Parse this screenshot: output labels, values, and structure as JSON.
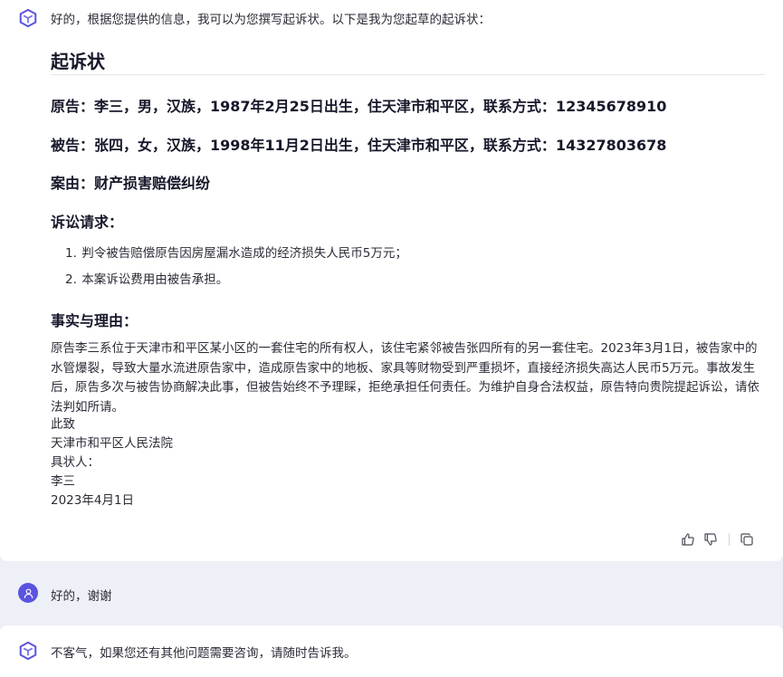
{
  "assistant_message": {
    "intro": "好的，根据您提供的信息，我可以为您撰写起诉状。以下是我为您起草的起诉状：",
    "title": "起诉状",
    "plaintiff": "原告：李三，男，汉族，1987年2月25日出生，住天津市和平区，联系方式：12345678910",
    "defendant": "被告：张四，女，汉族，1998年11月2日出生，住天津市和平区，联系方式：14327803678",
    "cause": "案由：财产损害赔偿纠纷",
    "claims_heading": "诉讼请求：",
    "claims": [
      {
        "num": "1.",
        "text": "判令被告赔偿原告因房屋漏水造成的经济损失人民币5万元；"
      },
      {
        "num": "2.",
        "text": "本案诉讼费用由被告承担。"
      }
    ],
    "facts_heading": "事实与理由：",
    "facts_body": "原告李三系位于天津市和平区某小区的一套住宅的所有权人，该住宅紧邻被告张四所有的另一套住宅。2023年3月1日，被告家中的水管爆裂，导致大量水流进原告家中，造成原告家中的地板、家具等财物受到严重损坏，直接经济损失高达人民币5万元。事故发生后，原告多次与被告协商解决此事，但被告始终不予理睬，拒绝承担任何责任。为维护自身合法权益，原告特向贵院提起诉讼，请依法判如所请。",
    "closing_line1": "此致",
    "closing_line2": "天津市和平区人民法院",
    "closing_line3": "具状人：",
    "closing_line4": "李三",
    "closing_date": "2023年4月1日",
    "actions": [
      "thumbs-up-icon",
      "thumbs-down-icon",
      "copy-icon"
    ]
  },
  "user_message": {
    "text": "好的，谢谢"
  },
  "assistant_reply": {
    "text": "不客气，如果您还有其他问题需要咨询，请随时告诉我。"
  },
  "colors": {
    "background": "#eef0f7",
    "card": "#ffffff",
    "accent": "#5b53e0"
  }
}
